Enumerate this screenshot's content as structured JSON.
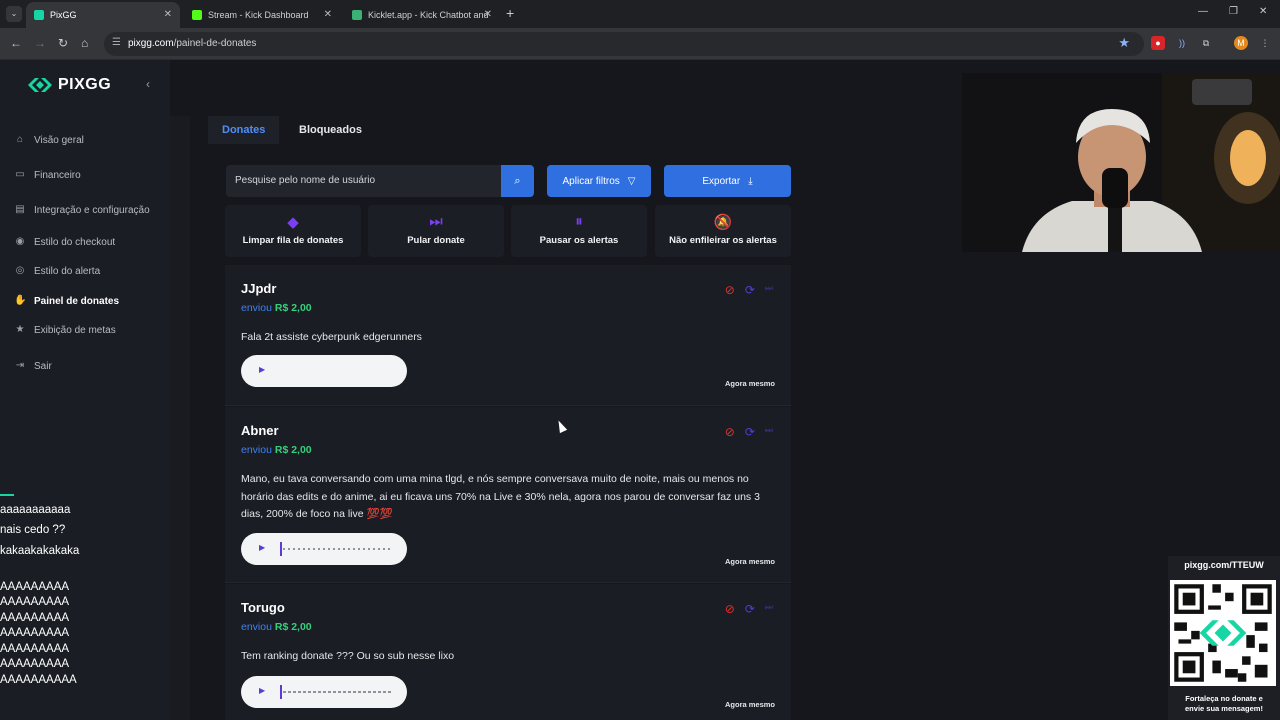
{
  "browser": {
    "tabs": [
      {
        "title": "PixGG",
        "color": "#16d6a3",
        "active": true
      },
      {
        "title": "Stream - Kick Dashboard",
        "color": "#53fc18",
        "active": false
      },
      {
        "title": "Kicklet.app - Kick Chatbot and",
        "color": "#3bb273",
        "active": false
      }
    ],
    "url_host": "pixgg.com",
    "url_path": "/painel-de-donates",
    "profile_initial": "M"
  },
  "sidebar": {
    "brand": "PIXGG",
    "items": [
      {
        "label": "Visão geral",
        "icon": "home-icon",
        "glyph": "⌂"
      },
      {
        "label": "Financeiro",
        "icon": "wallet-icon",
        "glyph": "▭"
      },
      {
        "label": "Integração e configuração",
        "icon": "link-icon",
        "glyph": "▤"
      },
      {
        "label": "Estilo do checkout",
        "icon": "palette-icon",
        "glyph": "◉"
      },
      {
        "label": "Estilo do alerta",
        "icon": "alert-style-icon",
        "glyph": "◎"
      },
      {
        "label": "Painel de donates",
        "icon": "hand-coin-icon",
        "glyph": "✋",
        "active": true
      },
      {
        "label": "Exibição de metas",
        "icon": "star-icon",
        "glyph": "★"
      },
      {
        "label": "Sair",
        "icon": "logout-icon",
        "glyph": "⇥"
      }
    ]
  },
  "chat_overlay": {
    "lines": [
      "",
      "aaaaaaaaaaa",
      "nais cedo ??",
      "kakaakakakaka",
      "",
      "AAAAAAAAA",
      "AAAAAAAAA",
      "AAAAAAAAA",
      "AAAAAAAAA",
      "AAAAAAAAA",
      "AAAAAAAAA",
      "AAAAAAAAAA"
    ]
  },
  "page": {
    "tabs": [
      "Donates",
      "Bloqueados"
    ],
    "search_placeholder": "Pesquise pelo nome de usuário",
    "filter_button": "Aplicar filtros",
    "export_button": "Exportar",
    "actions": [
      {
        "label": "Limpar fila de donates",
        "icon": "eraser-icon",
        "glyph": "◆"
      },
      {
        "label": "Pular donate",
        "icon": "skip-icon",
        "glyph": "⏭"
      },
      {
        "label": "Pausar os alertas",
        "icon": "pause-icon",
        "glyph": "⏸"
      },
      {
        "label": "Não enfileirar os alertas",
        "icon": "bell-off-icon",
        "glyph": "🔕"
      }
    ]
  },
  "donates": [
    {
      "name": "JJpdr",
      "verb": "enviou",
      "amount": "R$ 2,00",
      "message": "Fala 2t assiste cyberpunk edgerunners",
      "time": "Agora mesmo"
    },
    {
      "name": "Abner",
      "verb": "enviou",
      "amount": "R$ 2,00",
      "message": "Mano, eu tava conversando com uma mina tlgd, e nós sempre conversava muito de noite, mais ou menos no horário das edits e do anime, ai eu ficava uns 70% na Live e 30% nela, agora nos parou de conversar faz uns 3 dias, 200% de foco na live 💯💯",
      "time": "Agora mesmo"
    },
    {
      "name": "Torugo",
      "verb": "enviou",
      "amount": "R$ 2,00",
      "message": "Tem ranking donate ??? Ou so sub nesse lixo",
      "time": "Agora mesmo"
    }
  ],
  "overlay": {
    "qr_title": "pixgg.com/TTEUW",
    "qr_footer_1": "Fortaleça no donate e",
    "qr_footer_2": "envie sua mensagem!"
  }
}
